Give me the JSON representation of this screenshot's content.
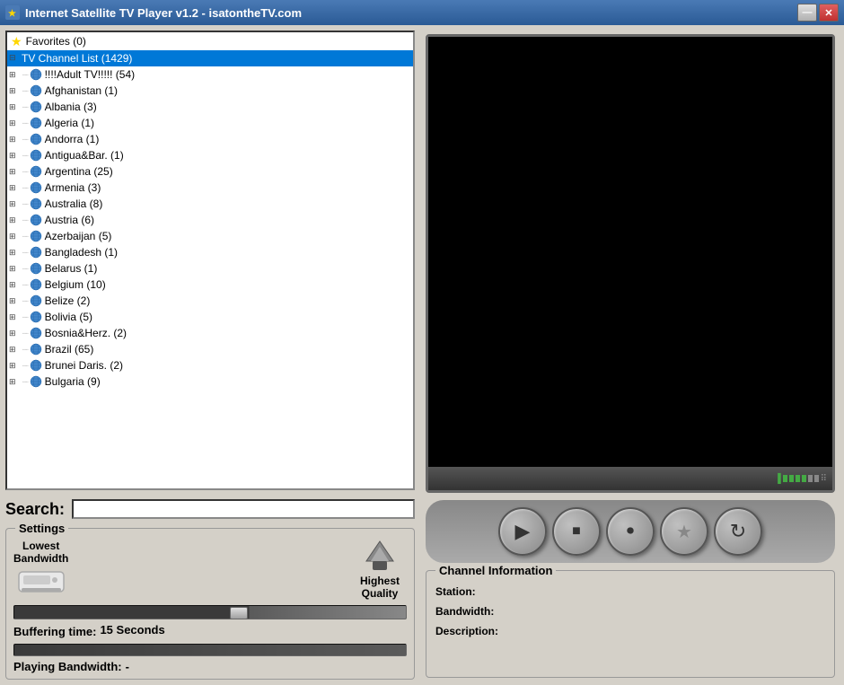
{
  "window": {
    "title": "Internet Satellite TV Player v1.2 - isatontheTV.com",
    "min_button": "—",
    "close_button": "✕"
  },
  "sidebar": {
    "favorites_label": "Favorites (0)",
    "channel_list_label": "TV Channel List (1429)",
    "items": [
      {
        "label": "!!!!Adult TV!!!!! (54)",
        "indent": 1
      },
      {
        "label": "Afghanistan (1)",
        "indent": 1
      },
      {
        "label": "Albania (3)",
        "indent": 1
      },
      {
        "label": "Algeria (1)",
        "indent": 1
      },
      {
        "label": "Andorra (1)",
        "indent": 1
      },
      {
        "label": "Antigua&Bar. (1)",
        "indent": 1
      },
      {
        "label": "Argentina (25)",
        "indent": 1
      },
      {
        "label": "Armenia (3)",
        "indent": 1
      },
      {
        "label": "Australia (8)",
        "indent": 1
      },
      {
        "label": "Austria (6)",
        "indent": 1
      },
      {
        "label": "Azerbaijan (5)",
        "indent": 1
      },
      {
        "label": "Bangladesh (1)",
        "indent": 1
      },
      {
        "label": "Belarus (1)",
        "indent": 1
      },
      {
        "label": "Belgium (10)",
        "indent": 1
      },
      {
        "label": "Belize (2)",
        "indent": 1
      },
      {
        "label": "Bolivia (5)",
        "indent": 1
      },
      {
        "label": "Bosnia&Herz. (2)",
        "indent": 1
      },
      {
        "label": "Brazil (65)",
        "indent": 1
      },
      {
        "label": "Brunei Daris. (2)",
        "indent": 1
      },
      {
        "label": "Bulgaria (9)",
        "indent": 1
      }
    ]
  },
  "search": {
    "label": "Search:",
    "placeholder": "",
    "value": ""
  },
  "settings": {
    "title": "Settings",
    "lowest_bandwidth_label": "Lowest\nBandwidth",
    "highest_quality_label": "Highest\nQuality",
    "buffering_label": "Buffering time:",
    "buffering_value": "15 Seconds",
    "playing_bw_label": "Playing Bandwidth:",
    "playing_bw_value": "-"
  },
  "channel_info": {
    "title": "Channel Information",
    "station_label": "Station:",
    "station_value": "",
    "bandwidth_label": "Bandwidth:",
    "bandwidth_value": "",
    "description_label": "Description:",
    "description_value": ""
  },
  "player": {
    "play_icon": "▶",
    "stop_icon": "■",
    "record_icon": "⏺",
    "favorite_icon": "★",
    "refresh_icon": "↻"
  }
}
